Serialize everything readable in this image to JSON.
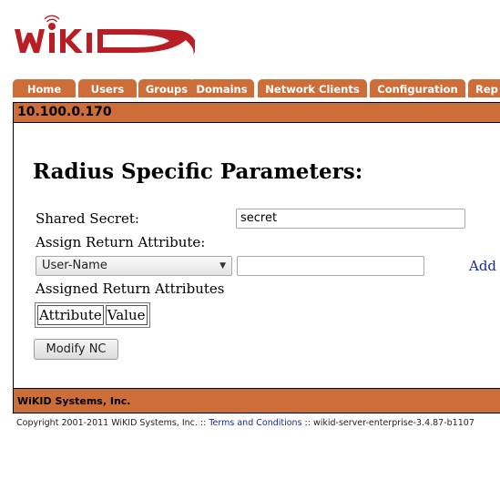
{
  "logo": {
    "text": "WIKID"
  },
  "tabs": [
    {
      "label": "Home"
    },
    {
      "label": "Users"
    },
    {
      "label": "Groups"
    },
    {
      "label": "Domains"
    },
    {
      "label": "Network Clients"
    },
    {
      "label": "Configuration"
    },
    {
      "label": "Rep"
    }
  ],
  "header": {
    "ip": "10.100.0.170"
  },
  "main": {
    "title": "Radius Specific Parameters:",
    "shared_secret_label": "Shared Secret:",
    "shared_secret_value": "secret",
    "assign_label": "Assign Return Attribute:",
    "attribute_select_value": "User-Name",
    "attribute_value_input": "",
    "add_link": "Add",
    "assigned_label": "Assigned Return Attributes",
    "table_headers": [
      "Attribute",
      "Value"
    ],
    "modify_button": "Modify NC"
  },
  "footer": {
    "company": "WiKID Systems, Inc.",
    "copyright_prefix": "Copyright 2001-2011 WiKID Systems, Inc. :: ",
    "terms_link": "Terms and Conditions",
    "copyright_suffix": " :: wikid-server-enterprise-3.4.87-b1107"
  },
  "colors": {
    "accent": "#cd6d37",
    "logo_red": "#b81e24",
    "link": "#1a2a8c"
  }
}
